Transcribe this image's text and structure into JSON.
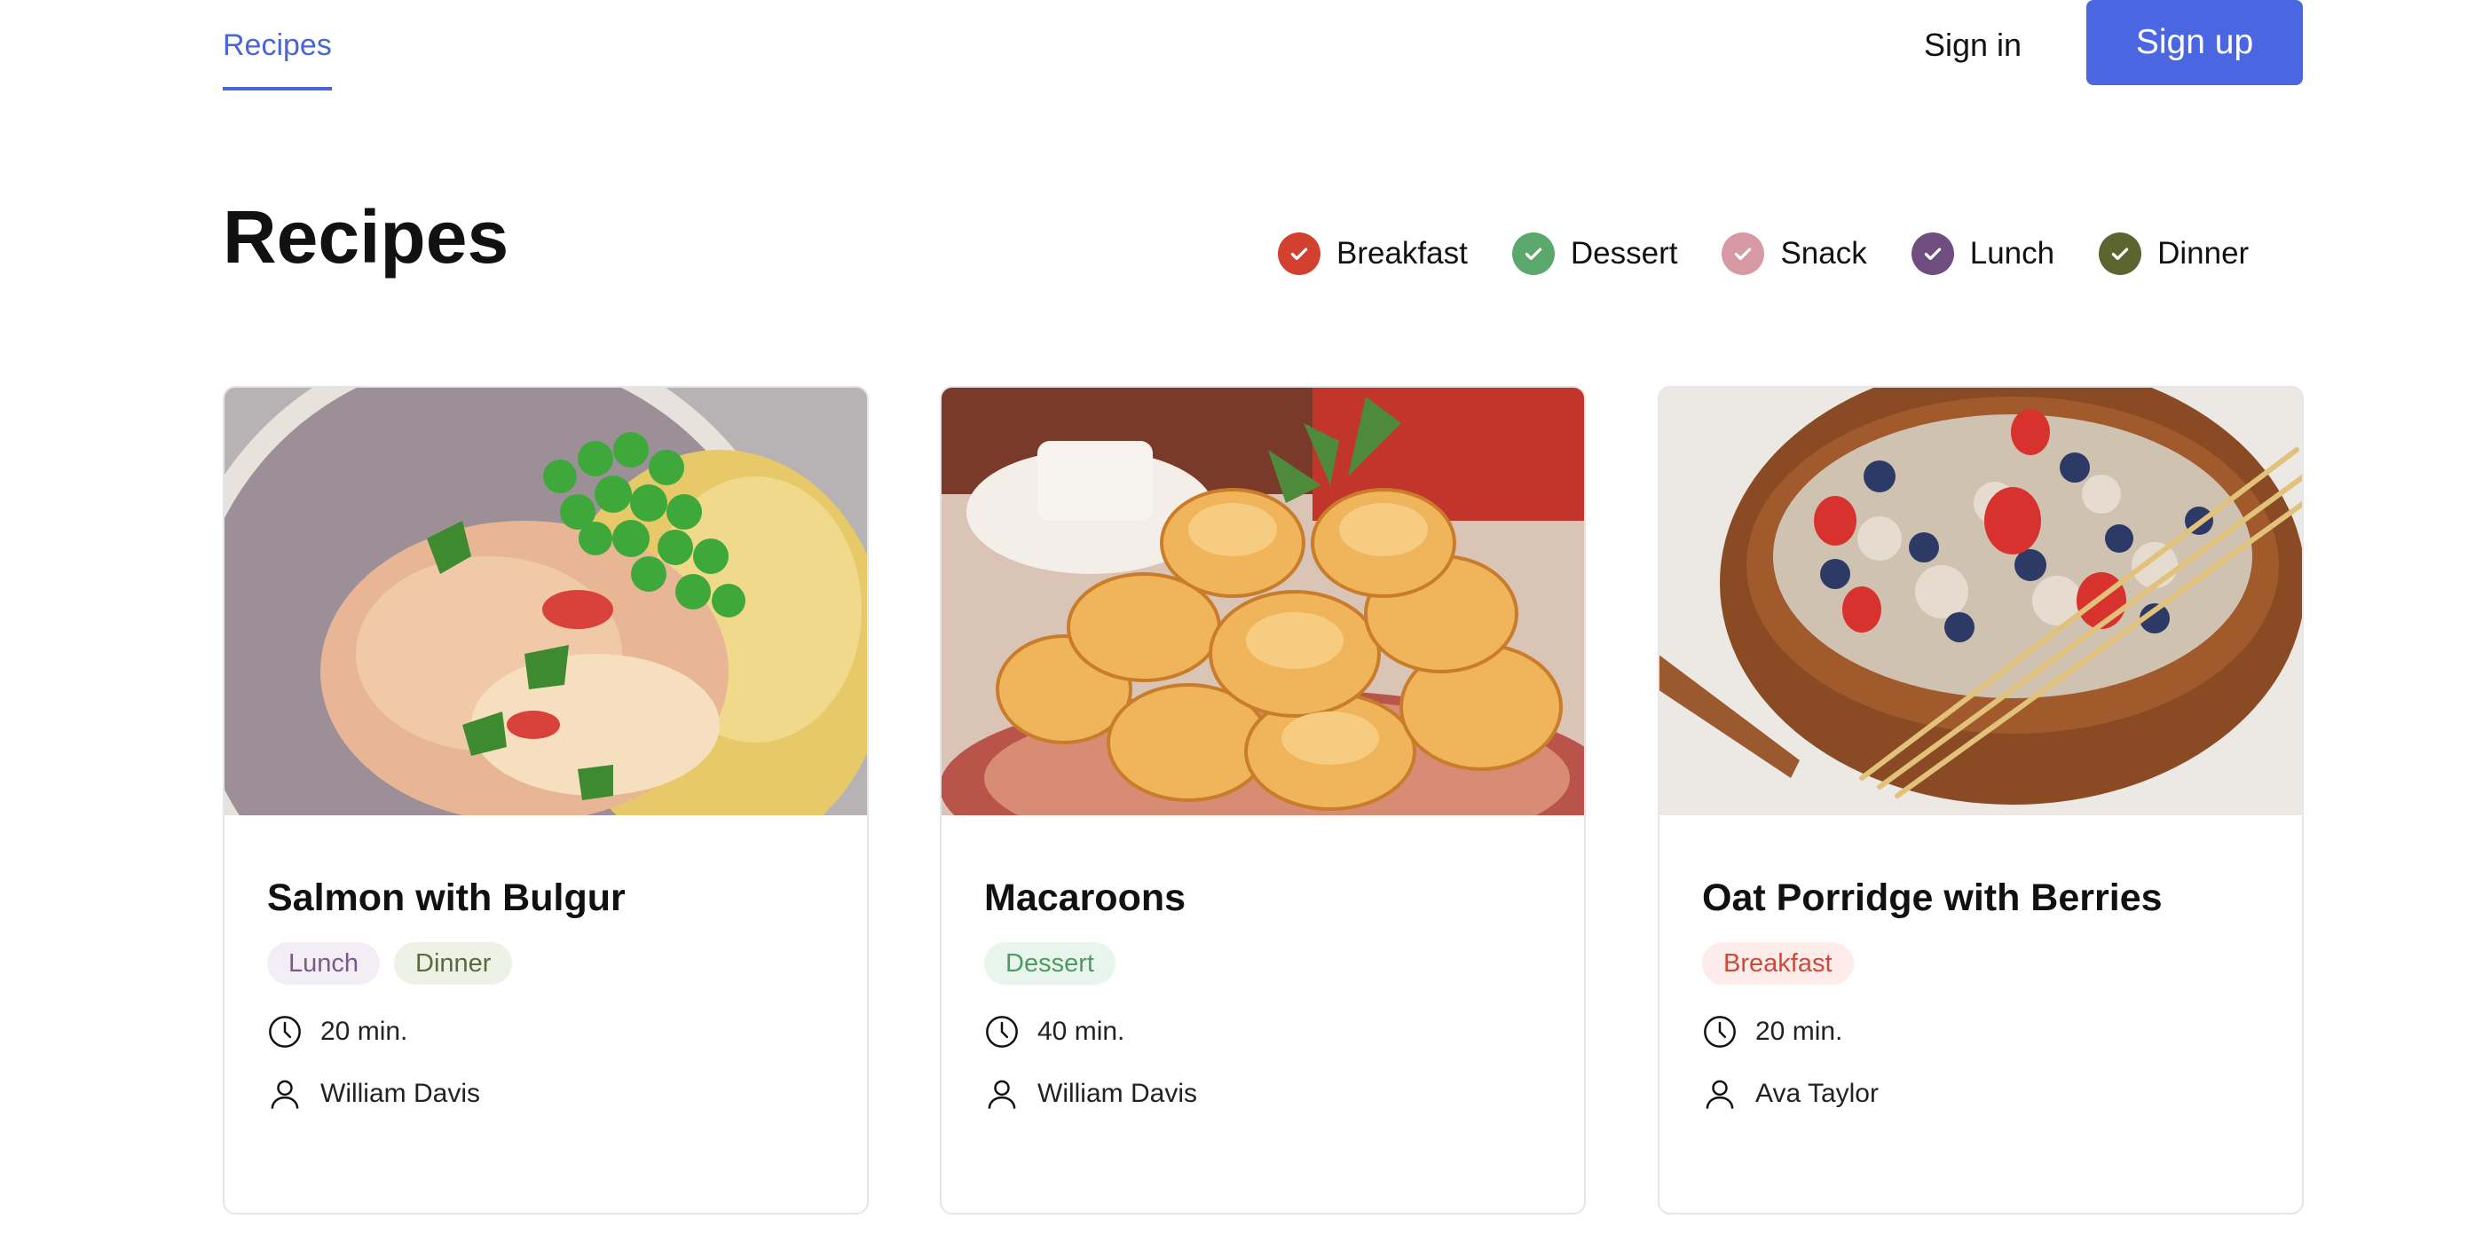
{
  "header": {
    "nav_tab": "Recipes",
    "sign_in": "Sign in",
    "sign_up": "Sign up"
  },
  "page": {
    "title": "Recipes"
  },
  "filters": [
    {
      "label": "Breakfast",
      "color": "#d2412f"
    },
    {
      "label": "Dessert",
      "color": "#5aa86c"
    },
    {
      "label": "Snack",
      "color": "#d79aa4"
    },
    {
      "label": "Lunch",
      "color": "#6f4d7e"
    },
    {
      "label": "Dinner",
      "color": "#5c6530"
    }
  ],
  "cards": [
    {
      "title": "Salmon with Bulgur",
      "image": "salmon-bulgur-photo",
      "tags": [
        {
          "label": "Lunch",
          "text_color": "#7b5a88",
          "bg_color": "#f3eef5"
        },
        {
          "label": "Dinner",
          "text_color": "#5b6a3a",
          "bg_color": "#eef1e6"
        }
      ],
      "time": "20 min.",
      "author": "William Davis"
    },
    {
      "title": "Macaroons",
      "image": "macaroons-photo",
      "tags": [
        {
          "label": "Dessert",
          "text_color": "#4f9a62",
          "bg_color": "#e8f5ec"
        }
      ],
      "time": "40 min.",
      "author": "William Davis"
    },
    {
      "title": "Oat Porridge with Berries",
      "image": "oat-porridge-photo",
      "tags": [
        {
          "label": "Breakfast",
          "text_color": "#cc4a3a",
          "bg_color": "#fdecea"
        }
      ],
      "time": "20 min.",
      "author": "Ava Taylor"
    }
  ]
}
